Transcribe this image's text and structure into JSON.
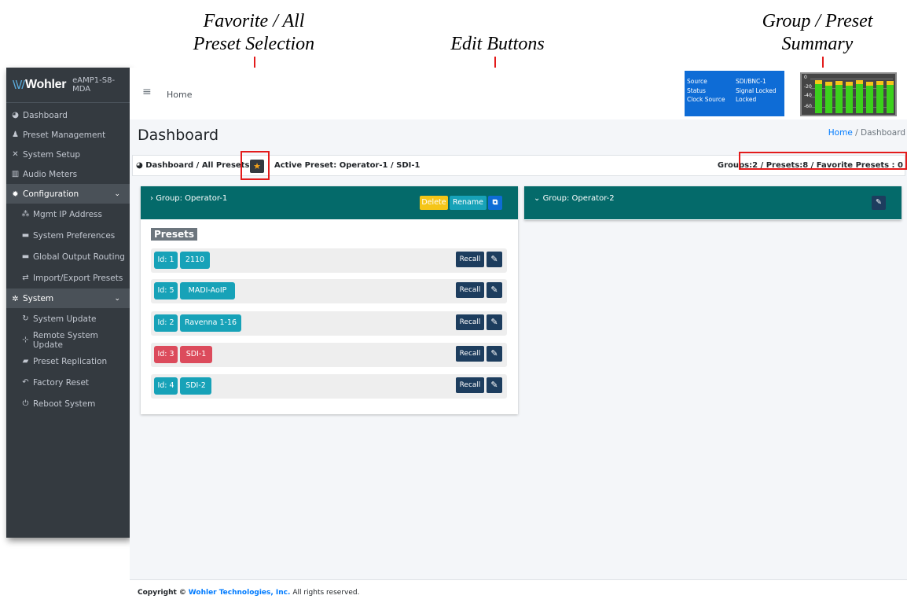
{
  "annotations": {
    "favorite": [
      "Favorite / All",
      "Preset Selection"
    ],
    "edit": "Edit Buttons",
    "summary": [
      "Group / Preset",
      "Summary"
    ]
  },
  "sidebar": {
    "brand": "Wohler",
    "model": "eAMP1-S8-MDA",
    "items": [
      {
        "label": "Dashboard",
        "icon": "dashboard-icon"
      },
      {
        "label": "Preset Management",
        "icon": "user-edit-icon"
      },
      {
        "label": "System Setup",
        "icon": "tools-icon"
      },
      {
        "label": "Audio Meters",
        "icon": "chart-icon"
      },
      {
        "label": "Configuration",
        "icon": "gear-icon"
      },
      {
        "label": "Mgmt IP Address",
        "icon": "network-icon"
      },
      {
        "label": "System Preferences",
        "icon": "ethernet-icon"
      },
      {
        "label": "Global Output Routing",
        "icon": "ethernet-icon"
      },
      {
        "label": "Import/Export Presets",
        "icon": "exchange-icon"
      },
      {
        "label": "System",
        "icon": "cogs-icon"
      },
      {
        "label": "System Update",
        "icon": "sync-icon"
      },
      {
        "label": "Remote System Update",
        "icon": "project-diagram-icon"
      },
      {
        "label": "Preset Replication",
        "icon": "clone-icon"
      },
      {
        "label": "Factory Reset",
        "icon": "undo-icon"
      },
      {
        "label": "Reboot System",
        "icon": "power-icon"
      }
    ]
  },
  "topbar": {
    "home": "Home",
    "status": [
      {
        "key": "Source",
        "value": "SDI/BNC-1"
      },
      {
        "key": "Status",
        "value": "Signal Locked"
      },
      {
        "key": "Clock Source",
        "value": "Locked"
      }
    ],
    "meter_scale": [
      "0",
      "-20",
      "-40",
      "-60"
    ],
    "meter_levels": [
      0.92,
      0.88,
      0.9,
      0.86,
      0.91,
      0.87,
      0.89,
      0.9
    ]
  },
  "page": {
    "title": "Dashboard",
    "crumb_home": "Home",
    "crumb_sep": "/",
    "crumb_current": "Dashboard",
    "info_left": "Dashboard / All Presets",
    "active_preset": "Active Preset: Operator-1 / SDI-1",
    "summary": "Groups:2 / Presets:8 / Favorite Presets : 0"
  },
  "group1": {
    "name": "Group: Operator-1",
    "delete": "Delete",
    "rename": "Rename",
    "presets_title": "Presets",
    "recall": "Recall",
    "presets": [
      {
        "id": "Id: 1",
        "name": "2110",
        "active": false
      },
      {
        "id": "Id: 5",
        "name": "MADI-AoIP",
        "active": false
      },
      {
        "id": "Id: 2",
        "name": "Ravenna 1-16",
        "active": false
      },
      {
        "id": "Id: 3",
        "name": "SDI-1",
        "active": true
      },
      {
        "id": "Id: 4",
        "name": "SDI-2",
        "active": false
      }
    ]
  },
  "group2": {
    "name": "Group: Operator-2"
  },
  "footer": {
    "copyright": "Copyright ©",
    "company": "Wohler Technologies, Inc.",
    "rights": "All rights reserved."
  },
  "colors": {
    "sidebar": "#343a40",
    "group_header": "#046a6a",
    "teal_badge": "#17a2b8",
    "active_badge": "#dc4b5c",
    "status_panel": "#0e6cd6",
    "annotation": "#e31b1b"
  }
}
